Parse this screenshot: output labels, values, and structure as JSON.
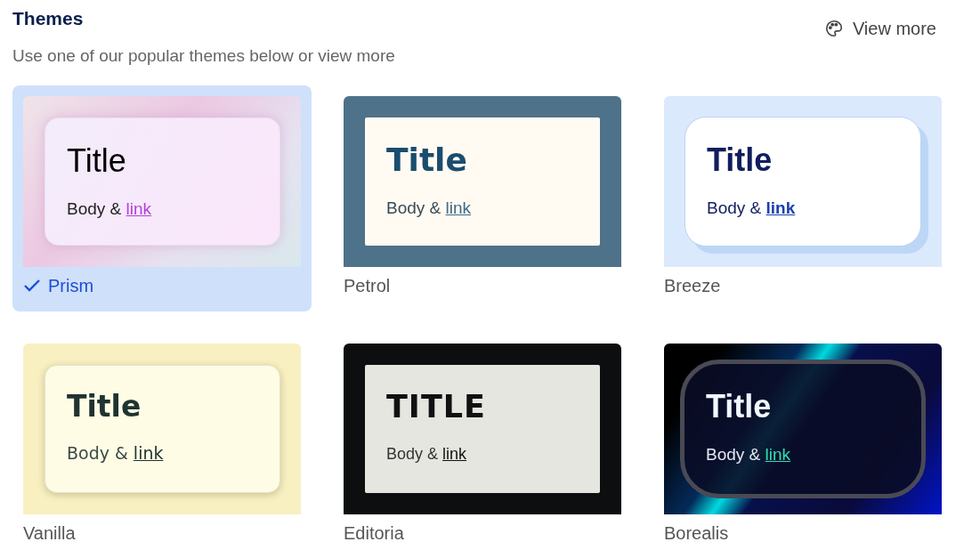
{
  "header": {
    "title": "Themes",
    "subtitle": "Use one of our popular themes below or view more",
    "view_more": "View more"
  },
  "themes": [
    {
      "kind": "prism",
      "name": "Prism",
      "selected": true,
      "title": "Title",
      "body": "Body & ",
      "link": "link"
    },
    {
      "kind": "petrol",
      "name": "Petrol",
      "selected": false,
      "title": "Title",
      "body": "Body & ",
      "link": "link"
    },
    {
      "kind": "breeze",
      "name": "Breeze",
      "selected": false,
      "title": "Title",
      "body": "Body & ",
      "link": "link"
    },
    {
      "kind": "vanilla",
      "name": "Vanilla",
      "selected": false,
      "title": "Title",
      "body": "Body & ",
      "link": "link"
    },
    {
      "kind": "editoria",
      "name": "Editoria",
      "selected": false,
      "title": "TITLE",
      "body": "Body & ",
      "link": "link"
    },
    {
      "kind": "borealis",
      "name": "Borealis",
      "selected": false,
      "title": "Title",
      "body": "Body & ",
      "link": "link"
    }
  ]
}
